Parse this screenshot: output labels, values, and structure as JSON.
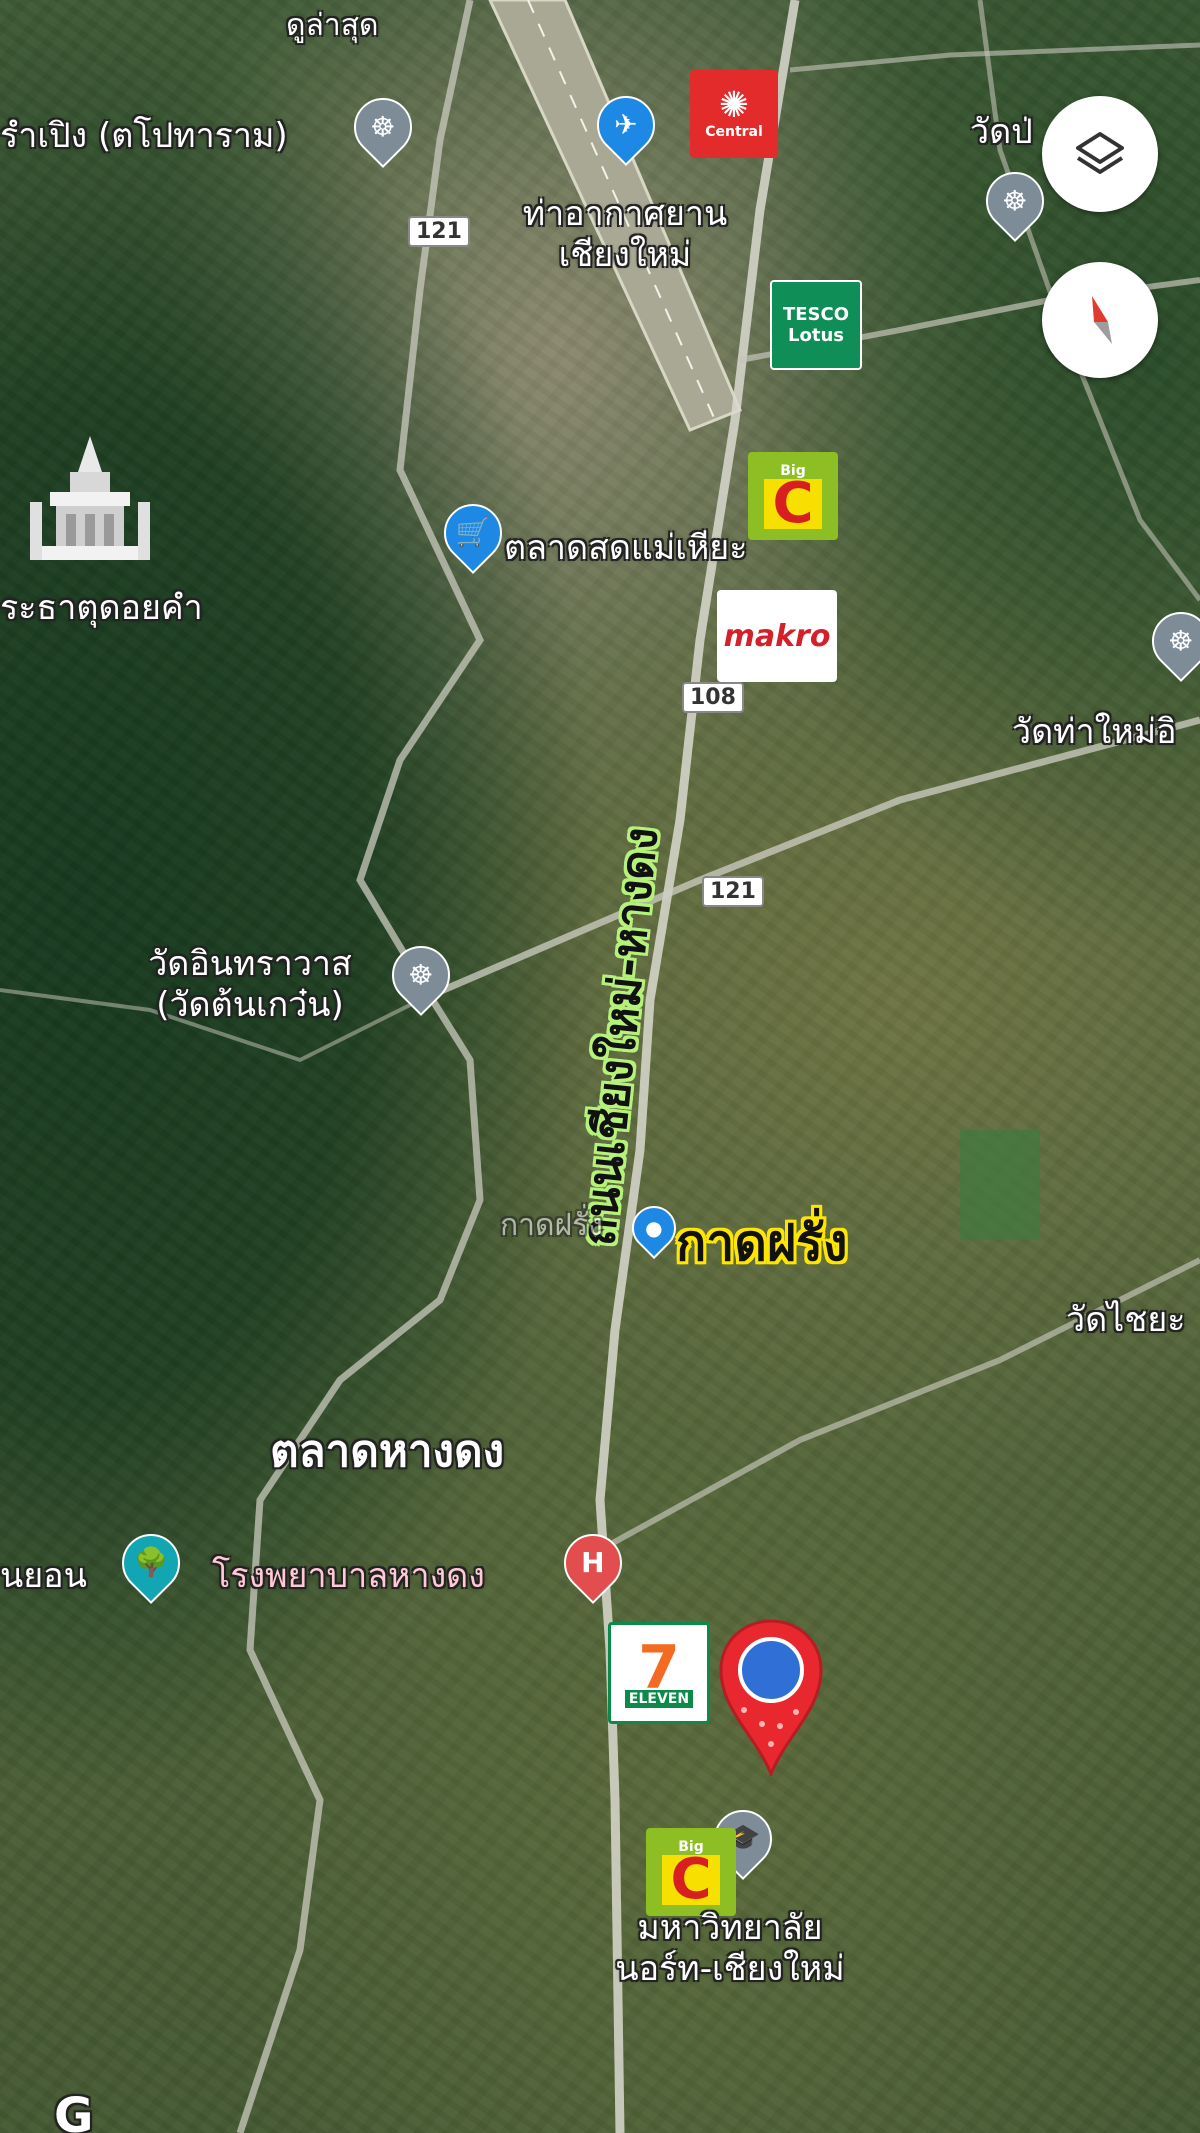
{
  "map": {
    "road_label": "ถนนเชียงใหม่-หางดง",
    "highlight_label": "กาดฝรั่ง",
    "market_label": "ตลาดหางดง",
    "labels": {
      "top_village": "ดูล่าสุด",
      "temple_left": "รำเปิง (ตโปทาราม)",
      "airport_line1": "ท่าอากาศยาน",
      "airport_line2": "เชียงใหม่",
      "temple_right_top": "วัดป่",
      "fresh_market": "ตลาดสดแม่เหียะ",
      "doi_kham": "ระธาตุดอยคำ",
      "wat_tha_mai": "วัดท่าใหม่อิ",
      "wat_in_line1": "วัดอินทราวาส",
      "wat_in_line2": "(วัดต้นเกว๋น)",
      "kad_small": "กาดฝรั่ง",
      "wat_chai": "วัดไชยะ",
      "left_park": "นยอน",
      "hospital": "โรงพยาบาลหางดง",
      "univ_line1": "มหาวิทยาลัย",
      "univ_line2": "นอร์ท-เชียงใหม่",
      "bottom_fragment": "G"
    },
    "route_shields": [
      "121",
      "108",
      "121"
    ],
    "brands": {
      "central": "Central",
      "tesco_line1": "TESCO",
      "tesco_line2": "Lotus",
      "bigc_small": "Big",
      "bigc_letter": "C",
      "makro": "makro",
      "seven_number": "7",
      "seven_text": "ELEVEN"
    },
    "icons": [
      "layers-icon",
      "compass-icon",
      "airport-icon",
      "temple-icon",
      "shopping-cart-icon",
      "hospital-icon",
      "park-icon",
      "school-icon",
      "location-pin-icon"
    ]
  }
}
